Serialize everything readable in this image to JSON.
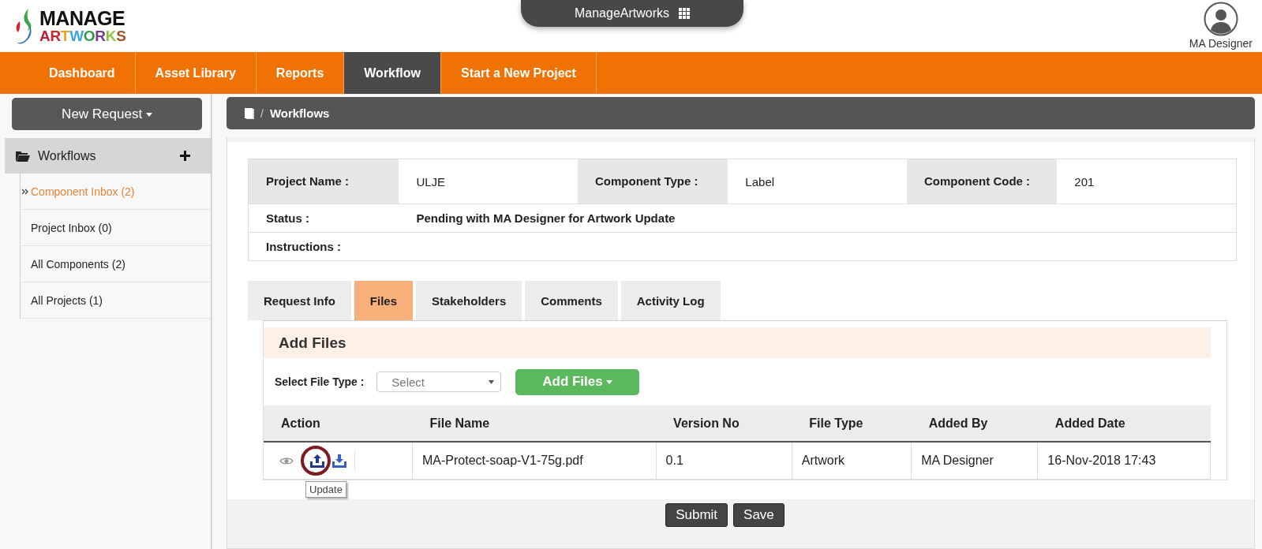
{
  "logo": {
    "line1": "MANAGE",
    "line2": "ARTWORKS"
  },
  "app_switcher": {
    "label": "ManageArtworks"
  },
  "user": {
    "name": "MA Designer"
  },
  "nav": [
    {
      "label": "Dashboard",
      "selected": false
    },
    {
      "label": "Asset Library",
      "selected": false
    },
    {
      "label": "Reports",
      "selected": false
    },
    {
      "label": "Workflow",
      "selected": true
    },
    {
      "label": "Start a New Project",
      "selected": false
    }
  ],
  "sidebar": {
    "new_request": "New Request",
    "section": "Workflows",
    "items": [
      {
        "label": "Component Inbox (2)",
        "selected": true
      },
      {
        "label": "Project Inbox (0)",
        "selected": false
      },
      {
        "label": "All Components (2)",
        "selected": false
      },
      {
        "label": "All Projects (1)",
        "selected": false
      }
    ]
  },
  "breadcrumb": {
    "separator": "/",
    "current": "Workflows"
  },
  "details": {
    "fields": [
      {
        "label": "Project Name :",
        "value": "ULJE"
      },
      {
        "label": "Component Type :",
        "value": "Label"
      },
      {
        "label": "Component Code :",
        "value": "201"
      }
    ],
    "status_label": "Status :",
    "status_value": "Pending with MA Designer for Artwork Update",
    "instructions_label": "Instructions :"
  },
  "tabs": [
    {
      "label": "Request Info",
      "selected": false
    },
    {
      "label": "Files",
      "selected": true
    },
    {
      "label": "Stakeholders",
      "selected": false
    },
    {
      "label": "Comments",
      "selected": false
    },
    {
      "label": "Activity Log",
      "selected": false
    }
  ],
  "files": {
    "heading": "Add Files",
    "file_type_label": "Select File Type :",
    "file_type_value": "Select",
    "add_button": "Add Files",
    "columns": [
      "Action",
      "File Name",
      "Version No",
      "File Type",
      "Added By",
      "Added Date"
    ],
    "rows": [
      {
        "file_name": "MA-Protect-soap-V1-75g.pdf",
        "version": "0.1",
        "file_type": "Artwork",
        "added_by": "MA Designer",
        "added_date": "16-Nov-2018 17:43"
      }
    ],
    "tooltip": "Update"
  },
  "buttons": [
    "Submit",
    "Save"
  ]
}
